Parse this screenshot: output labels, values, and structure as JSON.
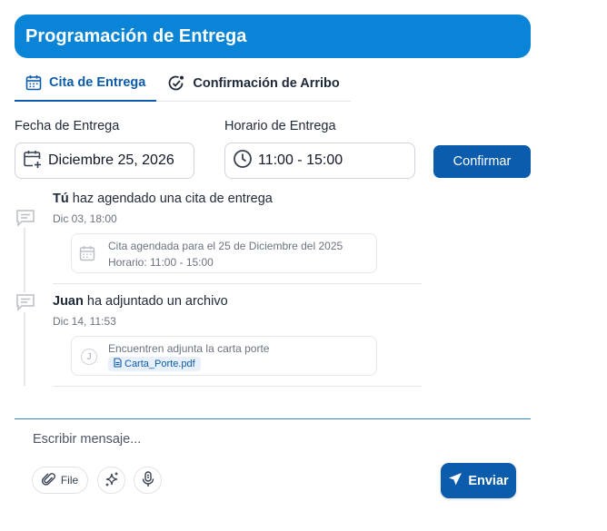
{
  "header": {
    "title": "Programación de Entrega"
  },
  "tabs": [
    {
      "label": "Cita de Entrega",
      "icon": "calendar-icon",
      "active": true
    },
    {
      "label": "Confirmación de Arribo",
      "icon": "check-circle-icon",
      "active": false
    }
  ],
  "form": {
    "date_label": "Fecha de Entrega",
    "date_value": "Diciembre 25, 2026",
    "time_label": "Horario de Entrega",
    "time_value": "11:00 - 15:00",
    "confirm_label": "Confirmar"
  },
  "timeline": [
    {
      "actor": "Tú",
      "action": "haz agendado una cita de entrega",
      "time": "Dic 03, 18:00",
      "attachment": {
        "icon": "calendar-icon",
        "line1": "Cita agendada para el 25 de Diciembre del 2025",
        "line2": "Horario: 11:00 - 15:00"
      }
    },
    {
      "actor": "Juan",
      "action": "ha adjuntado un archivo",
      "time": "Dic 14, 11:53",
      "attachment": {
        "avatar": "J",
        "line1": "Encuentren adjunta la carta porte",
        "file": "Carta_Porte.pdf"
      }
    }
  ],
  "composer": {
    "placeholder": "Escribir mensaje...",
    "file_label": "File",
    "send_label": "Enviar"
  },
  "colors": {
    "accent": "#0a84d6",
    "primary": "#0b5cad"
  }
}
